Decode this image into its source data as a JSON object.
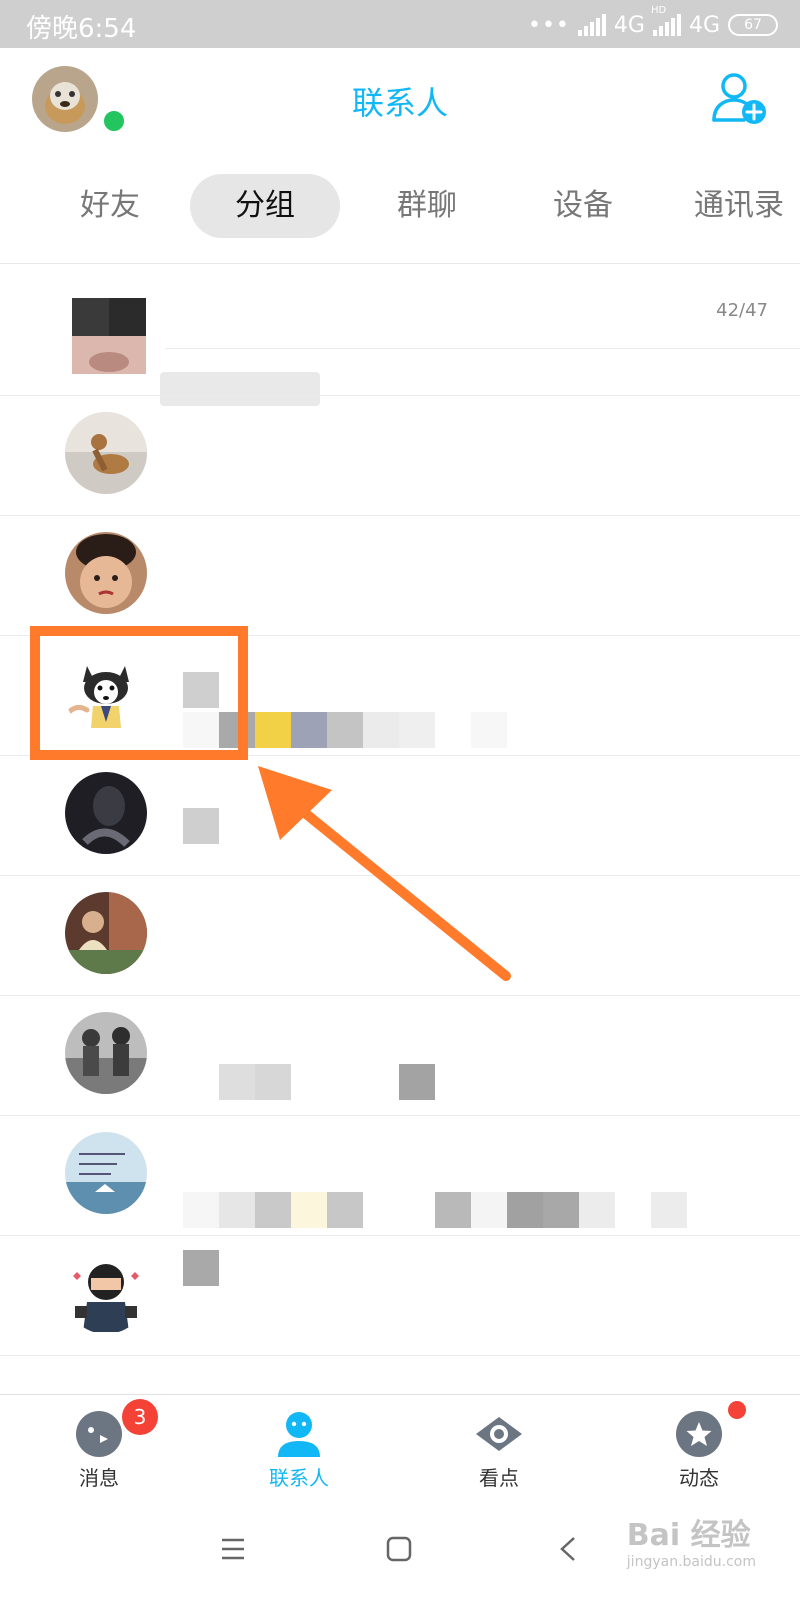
{
  "status_bar": {
    "time": "傍晚6:54",
    "network_1": "4G",
    "network_2": "4G",
    "hd": "HD",
    "battery": "67"
  },
  "header": {
    "title": "联系人"
  },
  "tabs": [
    {
      "label": "好友",
      "active": false
    },
    {
      "label": "分组",
      "active": true
    },
    {
      "label": "群聊",
      "active": false
    },
    {
      "label": "设备",
      "active": false
    },
    {
      "label": "通讯录",
      "active": false
    }
  ],
  "contacts": {
    "first_row_count": "42/47"
  },
  "bottom_nav": [
    {
      "label": "消息",
      "icon": "message-face-icon",
      "badge": "3"
    },
    {
      "label": "联系人",
      "icon": "contacts-person-icon",
      "active": true
    },
    {
      "label": "看点",
      "icon": "eye-icon"
    },
    {
      "label": "动态",
      "icon": "star-icon",
      "dot": true
    }
  ],
  "watermark": {
    "brand": "Bai 经验",
    "url": "jingyan.baidu.com"
  },
  "colors": {
    "accent": "#12b7f5",
    "highlight": "#ff7a2b",
    "badge": "#f44336",
    "online": "#22c55e"
  }
}
